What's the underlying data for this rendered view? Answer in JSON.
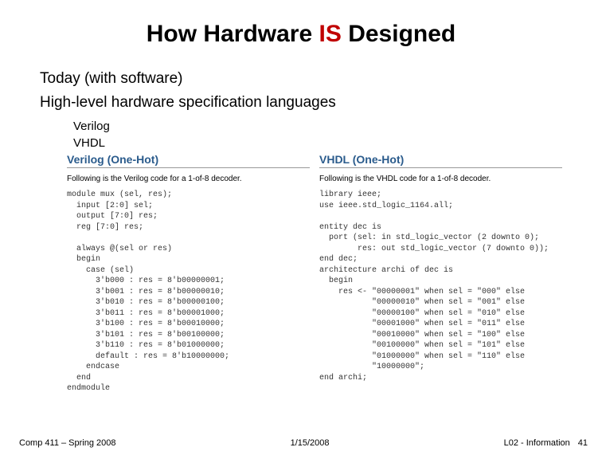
{
  "title": {
    "pre": "How Hardware ",
    "accent": "IS",
    "post": " Designed"
  },
  "line1": "Today (with software)",
  "line2": "High-level hardware specification languages",
  "sub1": "Verilog",
  "sub2": "VHDL",
  "left": {
    "heading": "Verilog (One-Hot)",
    "intro": "Following is the Verilog code for a 1-of-8 decoder.",
    "code": "module mux (sel, res);\n  input [2:0] sel;\n  output [7:0] res;\n  reg [7:0] res;\n\n  always @(sel or res)\n  begin\n    case (sel)\n      3'b000 : res = 8'b00000001;\n      3'b001 : res = 8'b00000010;\n      3'b010 : res = 8'b00000100;\n      3'b011 : res = 8'b00001000;\n      3'b100 : res = 8'b00010000;\n      3'b101 : res = 8'b00100000;\n      3'b110 : res = 8'b01000000;\n      default : res = 8'b10000000;\n    endcase\n  end\nendmodule"
  },
  "right": {
    "heading": "VHDL (One-Hot)",
    "intro": "Following is the VHDL code for a 1-of-8 decoder.",
    "code": "library ieee;\nuse ieee.std_logic_1164.all;\n\nentity dec is\n  port (sel: in std_logic_vector (2 downto 0);\n        res: out std_logic_vector (7 downto 0));\nend dec;\narchitecture archi of dec is\n  begin\n    res <- \"00000001\" when sel = \"000\" else\n           \"00000010\" when sel = \"001\" else\n           \"00000100\" when sel = \"010\" else\n           \"00001000\" when sel = \"011\" else\n           \"00010000\" when sel = \"100\" else\n           \"00100000\" when sel = \"101\" else\n           \"01000000\" when sel = \"110\" else\n           \"10000000\";\nend archi;"
  },
  "footer": {
    "left": "Comp 411 – Spring 2008",
    "center": "1/15/2008",
    "label": "L02 - Information",
    "page": "41"
  }
}
